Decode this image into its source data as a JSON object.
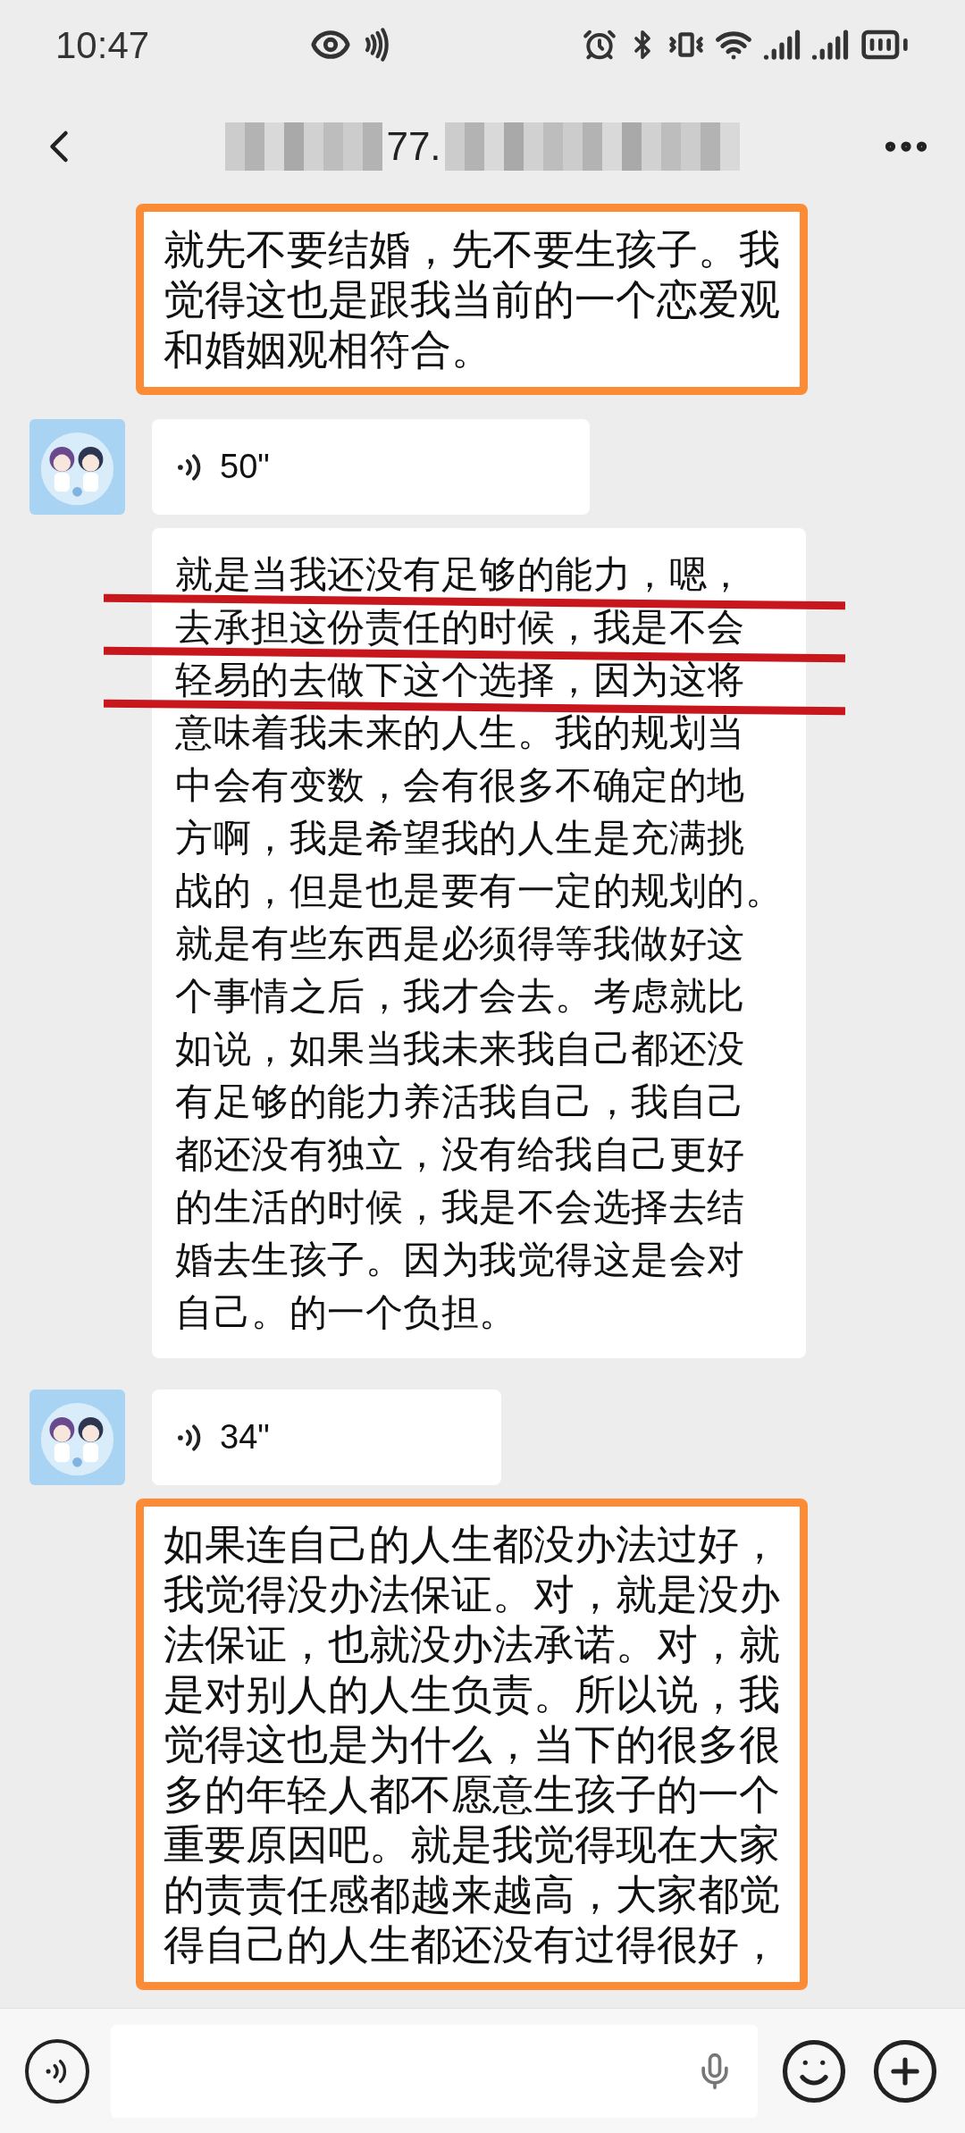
{
  "status_bar": {
    "time": "10:47"
  },
  "header": {
    "title": "77."
  },
  "messages": [
    {
      "kind": "text",
      "highlighted": true,
      "lines": [
        {
          "text": "就先不要结婚，先不要生孩子。我",
          "marked": false
        },
        {
          "text": "觉得这也是跟我当前的一个恋爱观",
          "marked": false
        },
        {
          "text": "和婚姻观相符合。",
          "marked": false
        }
      ]
    },
    {
      "kind": "voice",
      "show_avatar": true,
      "duration": "50\""
    },
    {
      "kind": "text",
      "highlighted": false,
      "lines": [
        {
          "text": "就是当我还没有足够的能力，嗯，",
          "marked": true
        },
        {
          "text": "去承担这份责任的时候，我是不会",
          "marked": true
        },
        {
          "text": "轻易的去做下这个选择，因为这将",
          "marked": true
        },
        {
          "text": "意味着我未来的人生。我的规划当",
          "marked": false
        },
        {
          "text": "中会有变数，会有很多不确定的地",
          "marked": false
        },
        {
          "text": "方啊，我是希望我的人生是充满挑",
          "marked": false
        },
        {
          "text": "战的，但是也是要有一定的规划的。",
          "marked": false
        },
        {
          "text": "就是有些东西是必须得等我做好这",
          "marked": false
        },
        {
          "text": "个事情之后，我才会去。考虑就比",
          "marked": false
        },
        {
          "text": "如说，如果当我未来我自己都还没",
          "marked": false
        },
        {
          "text": "有足够的能力养活我自己，我自己",
          "marked": false
        },
        {
          "text": "都还没有独立，没有给我自己更好",
          "marked": false
        },
        {
          "text": "的生活的时候，我是不会选择去结",
          "marked": false
        },
        {
          "text": "婚去生孩子。因为我觉得这是会对",
          "marked": false
        },
        {
          "text": "自己。的一个负担。",
          "marked": false
        }
      ]
    },
    {
      "kind": "voice",
      "show_avatar": true,
      "duration": "34\""
    },
    {
      "kind": "text",
      "highlighted": true,
      "lines": [
        {
          "text": "如果连自己的人生都没办法过好，",
          "marked": false
        },
        {
          "text": "我觉得没办法保证。对，就是没办",
          "marked": false
        },
        {
          "text": "法保证，也就没办法承诺。对，就",
          "marked": false
        },
        {
          "text": "是对别人的人生负责。所以说，我",
          "marked": false
        },
        {
          "text": "觉得这也是为什么，当下的很多很",
          "marked": false
        },
        {
          "text": "多的年轻人都不愿意生孩子的一个",
          "marked": false
        },
        {
          "text": "重要原因吧。就是我觉得现在大家",
          "marked": false
        },
        {
          "text": "的责责任感都越来越高，大家都觉",
          "marked": false
        },
        {
          "text": "得自己的人生都还没有过得很好，",
          "marked": false
        }
      ]
    }
  ]
}
